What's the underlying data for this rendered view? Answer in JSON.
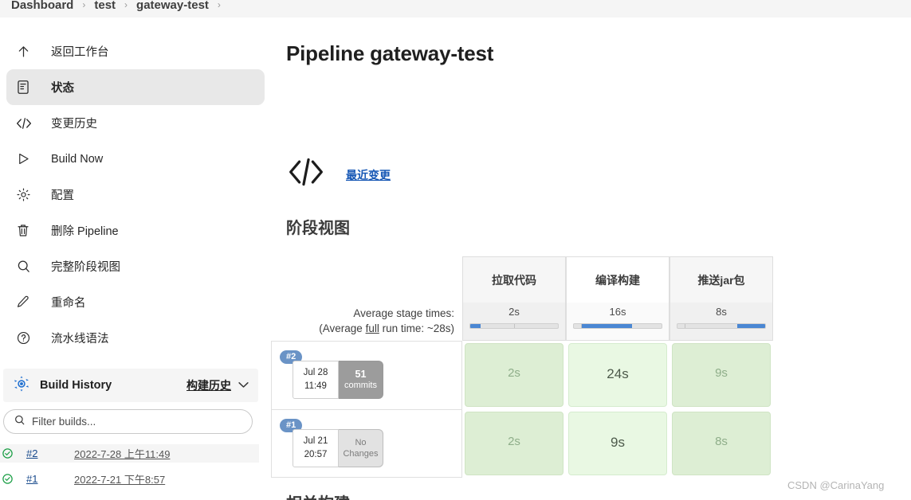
{
  "breadcrumb": {
    "items": [
      "Dashboard",
      "test",
      "gateway-test"
    ],
    "separator": "›"
  },
  "sidebar": {
    "items": [
      {
        "label": "返回工作台",
        "icon": "arrow-up-icon",
        "active": false
      },
      {
        "label": "状态",
        "icon": "document-icon",
        "active": true
      },
      {
        "label": "变更历史",
        "icon": "code-icon",
        "active": false
      },
      {
        "label": "Build Now",
        "icon": "play-icon",
        "active": false
      },
      {
        "label": "配置",
        "icon": "gear-icon",
        "active": false
      },
      {
        "label": "删除 Pipeline",
        "icon": "trash-icon",
        "active": false
      },
      {
        "label": "完整阶段视图",
        "icon": "search-icon",
        "active": false
      },
      {
        "label": "重命名",
        "icon": "pencil-icon",
        "active": false
      },
      {
        "label": "流水线语法",
        "icon": "question-icon",
        "active": false
      }
    ]
  },
  "build_history": {
    "title": "Build History",
    "link_label": "构建历史",
    "chevron": "⌄",
    "search_placeholder": "Filter builds...",
    "builds": [
      {
        "number": "#2",
        "date": "2022-7-28 上午11:49",
        "status": "success"
      },
      {
        "number": "#1",
        "date": "2022-7-21 下午8:57",
        "status": "success"
      }
    ]
  },
  "main": {
    "page_title": "Pipeline gateway-test",
    "changes_link": "最近变更",
    "stage_view_title": "阶段视图",
    "bottom_heading": "相关构建"
  },
  "chart_data": {
    "type": "table",
    "title": "阶段视图",
    "average_label_line1": "Average stage times:",
    "average_label_line2_pre": "(Average ",
    "average_label_line2_em": "full",
    "average_label_line2_post": " run time: ~28s)",
    "categories": [
      "拉取代码",
      "编译构建",
      "推送jar包"
    ],
    "average_times": [
      "2s",
      "16s",
      "8s"
    ],
    "average_bars": [
      {
        "fill_start_pct": 0,
        "fill_width_pct": 12,
        "tick_pct": 50
      },
      {
        "fill_start_pct": 8,
        "fill_width_pct": 58,
        "tick_pct": 8
      },
      {
        "fill_start_pct": 68,
        "fill_width_pct": 32,
        "tick_pct": 8
      }
    ],
    "highlight_column_index": 1,
    "rows": [
      {
        "number": "#2",
        "date": "Jul 28",
        "time": "11:49",
        "commits_value": "51",
        "commits_label": "commits",
        "no_changes": false,
        "values": [
          "2s",
          "24s",
          "9s"
        ]
      },
      {
        "number": "#1",
        "date": "Jul 21",
        "time": "20:57",
        "commits_value": "No",
        "commits_label": "Changes",
        "no_changes": true,
        "values": [
          "2s",
          "9s",
          "8s"
        ]
      }
    ]
  },
  "watermark": "CSDN @CarinaYang",
  "colors": {
    "accent_blue": "#1657b5",
    "bar_blue": "#4a87d3",
    "success_green": "#16a34a",
    "cell_green": "#ddeed4",
    "cell_green_hl": "#e9f8e3",
    "badge_blue": "#6a93c6"
  }
}
